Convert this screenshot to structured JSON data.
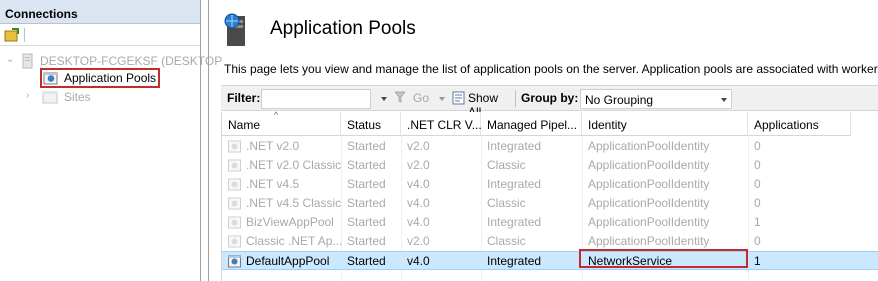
{
  "connections": {
    "title": "Connections",
    "tree": {
      "server": "DESKTOP-FCGEKSF (DESKTOP",
      "app_pools": "Application Pools",
      "sites": "Sites"
    }
  },
  "page": {
    "title": "Application Pools",
    "description": "This page lets you view and manage the list of application pools on the server. Application pools are associated with worker p"
  },
  "filterbar": {
    "filter_label": "Filter:",
    "go_label": "Go",
    "show_all_label": "Show All",
    "group_by_label": "Group by:",
    "group_by_value": "No Grouping"
  },
  "table": {
    "columns": [
      "Name",
      "Status",
      ".NET CLR V...",
      "Managed Pipel...",
      "Identity",
      "Applications"
    ],
    "rows": [
      {
        "name": ".NET v2.0",
        "status": "Started",
        "clr": "v2.0",
        "pipeline": "Integrated",
        "identity": "ApplicationPoolIdentity",
        "apps": "0"
      },
      {
        "name": ".NET v2.0 Classic",
        "status": "Started",
        "clr": "v2.0",
        "pipeline": "Classic",
        "identity": "ApplicationPoolIdentity",
        "apps": "0"
      },
      {
        "name": ".NET v4.5",
        "status": "Started",
        "clr": "v4.0",
        "pipeline": "Integrated",
        "identity": "ApplicationPoolIdentity",
        "apps": "0"
      },
      {
        "name": ".NET v4.5 Classic",
        "status": "Started",
        "clr": "v4.0",
        "pipeline": "Classic",
        "identity": "ApplicationPoolIdentity",
        "apps": "0"
      },
      {
        "name": "BizViewAppPool",
        "status": "Started",
        "clr": "v4.0",
        "pipeline": "Integrated",
        "identity": "ApplicationPoolIdentity",
        "apps": "1"
      },
      {
        "name": "Classic .NET Ap...",
        "status": "Started",
        "clr": "v2.0",
        "pipeline": "Classic",
        "identity": "ApplicationPoolIdentity",
        "apps": "0"
      },
      {
        "name": "DefaultAppPool",
        "status": "Started",
        "clr": "v4.0",
        "pipeline": "Integrated",
        "identity": "NetworkService",
        "apps": "1"
      }
    ]
  },
  "colors": {
    "selection": "#cce8ff",
    "highlight_box": "#c42b2b",
    "greyed_text": "#a9a9a9"
  }
}
